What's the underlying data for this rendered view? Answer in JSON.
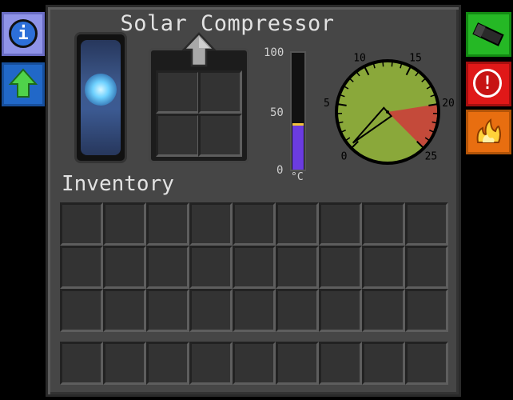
{
  "window": {
    "title": "Solar Compressor"
  },
  "inventory": {
    "label": "Inventory",
    "rows": 3,
    "cols": 9,
    "hotbar_cols": 9
  },
  "side_tabs": {
    "left": [
      {
        "name": "info",
        "icon": "info-icon",
        "glyph": "i",
        "color": "#8f93e8"
      },
      {
        "name": "upgrade",
        "icon": "arrow-up-icon",
        "color": "#2168c8"
      }
    ],
    "right": [
      {
        "name": "redstone",
        "icon": "redstone-torch-icon",
        "color": "#25b825"
      },
      {
        "name": "alert",
        "icon": "alert-icon",
        "glyph": "!",
        "color": "#e01818"
      },
      {
        "name": "heat",
        "icon": "flame-icon",
        "color": "#e86e10"
      }
    ]
  },
  "thermometer": {
    "labels": [
      "100",
      "50",
      "0"
    ],
    "unit": "°C",
    "level_percent": 40,
    "fill_color": "#6b3ce0"
  },
  "gauge": {
    "tick_labels": [
      "0",
      "5",
      "10",
      "15",
      "20",
      "25"
    ],
    "min": 0,
    "max": 25,
    "danger_start": 20,
    "needle_value": 0.3,
    "safe_color": "#8aa83a",
    "danger_color": "#c44a3a"
  }
}
